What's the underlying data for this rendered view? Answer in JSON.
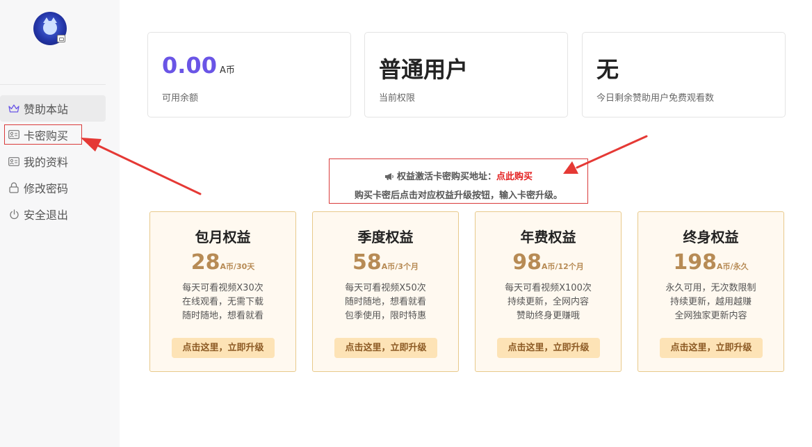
{
  "sidebar": {
    "items": [
      {
        "label": "赞助本站",
        "icon": "crown-icon"
      },
      {
        "label": "卡密购买",
        "icon": "id-card-icon"
      },
      {
        "label": "我的资料",
        "icon": "id-card-icon"
      },
      {
        "label": "修改密码",
        "icon": "lock-icon"
      },
      {
        "label": "安全退出",
        "icon": "power-icon"
      }
    ]
  },
  "stats": [
    {
      "value": "0.00",
      "unit": "A币",
      "label": "可用余额"
    },
    {
      "value": "普通用户",
      "label": "当前权限"
    },
    {
      "value": "无",
      "label": "今日剩余赞助用户免费观看数"
    }
  ],
  "notice": {
    "line1_prefix": "权益激活卡密购买地址：",
    "line1_link": "点此购买",
    "line2": "购买卡密后点击对应权益升级按钮，输入卡密升级。"
  },
  "plans": [
    {
      "title": "包月权益",
      "price": "28",
      "per": "A币/30天",
      "desc": [
        "每天可看视频X30次",
        "在线观看，无需下载",
        "随时随地，想看就看"
      ],
      "button": "点击这里，立即升级"
    },
    {
      "title": "季度权益",
      "price": "58",
      "per": "A币/3个月",
      "desc": [
        "每天可看视频X50次",
        "随时随地，想看就看",
        "包季使用，限时特惠"
      ],
      "button": "点击这里，立即升级"
    },
    {
      "title": "年费权益",
      "price": "98",
      "per": "A币/12个月",
      "desc": [
        "每天可看视频X100次",
        "持续更新，全网内容",
        "赞助终身更赚哦"
      ],
      "button": "点击这里，立即升级"
    },
    {
      "title": "终身权益",
      "price": "198",
      "per": "A币/永久",
      "desc": [
        "永久可用，无次数限制",
        "持续更新，越用越赚",
        "全网独家更新内容"
      ],
      "button": "点击这里，立即升级"
    }
  ],
  "colors": {
    "accent": "#6a55e6",
    "price": "#b78b55",
    "highlight": "#d93a3a",
    "button_bg": "#fde3b6"
  }
}
